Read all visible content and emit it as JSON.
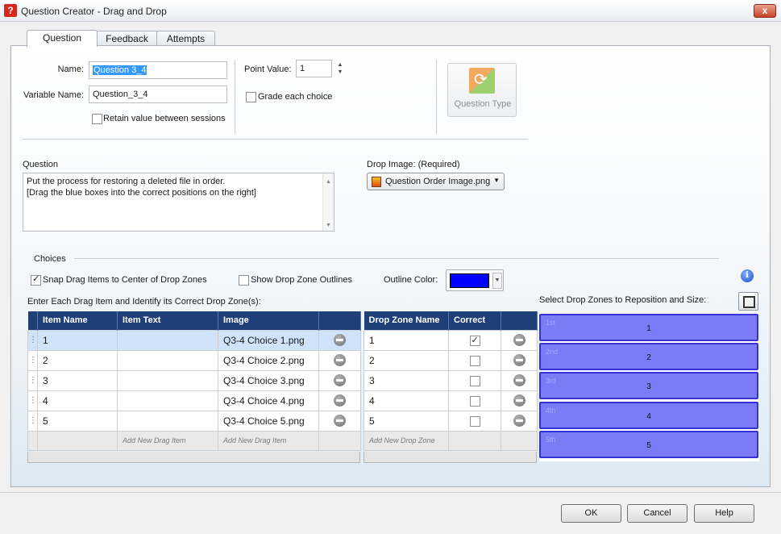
{
  "window": {
    "title": "Question Creator - Drag and Drop",
    "app_icon": "?",
    "close_glyph": "x"
  },
  "tabs": [
    {
      "label": "Question",
      "active": true
    },
    {
      "label": "Feedback",
      "active": false
    },
    {
      "label": "Attempts",
      "active": false
    }
  ],
  "form": {
    "name_label": "Name:",
    "name_value": "Question 3_4",
    "variable_label": "Variable Name:",
    "variable_value": "Question_3_4",
    "retain_label": "Retain value between sessions",
    "retain_checked": false,
    "point_label": "Point Value:",
    "point_value": "1",
    "grade_label": "Grade each choice",
    "grade_checked": false,
    "question_type_label": "Question Type"
  },
  "question": {
    "label": "Question",
    "line1": "Put the process for restoring a deleted file in order.",
    "line2": "[Drag the blue boxes into the correct positions on the right]"
  },
  "drop_image": {
    "label": "Drop Image: (Required)",
    "value": "Question Order Image.png"
  },
  "choices": {
    "section_label": "Choices",
    "snap_label": "Snap Drag Items to Center of Drop Zones",
    "snap_checked": true,
    "outline_label": "Show Drop Zone Outlines",
    "outline_checked": false,
    "outline_color_label": "Outline Color:",
    "outline_color": "#0000ff",
    "enter_label": "Enter Each Drag Item and Identify its Correct Drop Zone(s):",
    "select_label": "Select Drop Zones to Reposition and Size:"
  },
  "drag_table": {
    "headers": [
      "Item Name",
      "Item Text",
      "Image"
    ],
    "rows": [
      {
        "name": "1",
        "text": "",
        "image": "Q3-4 Choice 1.png"
      },
      {
        "name": "2",
        "text": "",
        "image": "Q3-4 Choice 2.png"
      },
      {
        "name": "3",
        "text": "",
        "image": "Q3-4 Choice 3.png"
      },
      {
        "name": "4",
        "text": "",
        "image": "Q3-4 Choice 4.png"
      },
      {
        "name": "5",
        "text": "",
        "image": "Q3-4 Choice 5.png"
      }
    ],
    "add_text": "Add New Drag Item",
    "add_image": "Add New Drag Item"
  },
  "zone_table": {
    "headers": [
      "Drop Zone Name",
      "Correct"
    ],
    "rows": [
      {
        "name": "1",
        "correct": true
      },
      {
        "name": "2",
        "correct": false
      },
      {
        "name": "3",
        "correct": false
      },
      {
        "name": "4",
        "correct": false
      },
      {
        "name": "5",
        "correct": false
      }
    ],
    "add_text": "Add New Drop Zone"
  },
  "zones": [
    {
      "tag": "1st",
      "label": "1"
    },
    {
      "tag": "2nd",
      "label": "2"
    },
    {
      "tag": "3rd",
      "label": "3"
    },
    {
      "tag": "4th",
      "label": "4"
    },
    {
      "tag": "5th",
      "label": "5"
    }
  ],
  "buttons": {
    "ok": "OK",
    "cancel": "Cancel",
    "help": "Help"
  },
  "colors": {
    "header": "#1f3f78",
    "zone_fill": "#7b7bf5",
    "zone_border": "#3232d6",
    "selected_row": "#cfe3fa"
  }
}
